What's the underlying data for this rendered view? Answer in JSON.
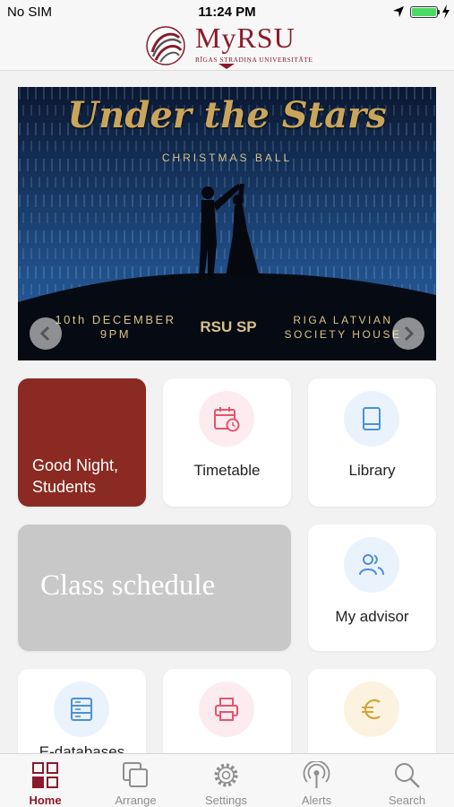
{
  "status_bar": {
    "carrier": "No SIM",
    "time": "11:24 PM",
    "battery_level": 1.0
  },
  "header": {
    "logo_text": "MyRSU",
    "logo_subtitle": "RĪGAS STRADIŅA UNIVERSITĀTE"
  },
  "banner": {
    "title": "Under the Stars",
    "subtitle": "CHRISTMAS BALL",
    "date_line1": "10th DECEMBER",
    "date_line2": "9PM",
    "organizer": "RSU SP",
    "venue_line1": "RIGA LATVIAN",
    "venue_line2": "SOCIETY HOUSE"
  },
  "greeting": {
    "line1": "Good Night,",
    "line2": "Students"
  },
  "tiles": {
    "timetable": "Timetable",
    "library": "Library",
    "class_schedule": "Class schedule",
    "my_advisor": "My advisor",
    "edatabases": "E-databases"
  },
  "tab_bar": [
    {
      "label": "Home",
      "icon": "home-grid-icon",
      "active": true
    },
    {
      "label": "Arrange",
      "icon": "arrange-icon",
      "active": false
    },
    {
      "label": "Settings",
      "icon": "gear-icon",
      "active": false
    },
    {
      "label": "Alerts",
      "icon": "broadcast-icon",
      "active": false
    },
    {
      "label": "Search",
      "icon": "search-icon",
      "active": false
    }
  ],
  "colors": {
    "brand": "#8b1a2b",
    "greeting_tile": "#8b2a22",
    "timetable_icon": "#e8536b",
    "library_icon": "#4a90d9",
    "advisor_icon": "#4a90d9",
    "databases_icon": "#4a90d9",
    "print_icon": "#e8536b",
    "payment_icon": "#d4a43a"
  }
}
